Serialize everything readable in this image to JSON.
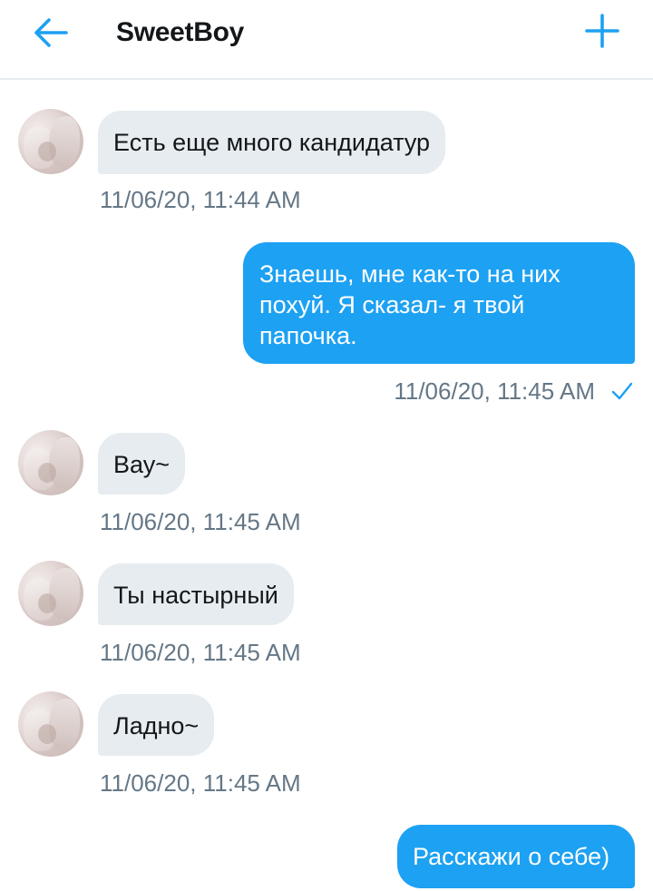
{
  "header": {
    "title": "SweetBoy",
    "back_icon": "arrow-left-icon",
    "add_icon": "plus-icon",
    "accent": "#1da1f2"
  },
  "messages": [
    {
      "direction": "in",
      "text": "Есть еще много кандидатур",
      "time": "11/06/20, 11:44 AM"
    },
    {
      "direction": "out",
      "text": "Знаешь, мне как-то на них похуй. Я сказал- я твой папочка.",
      "time": "11/06/20, 11:45 AM",
      "status_icon": "check-icon"
    },
    {
      "direction": "in",
      "text": "Вау~",
      "time": "11/06/20, 11:45 AM"
    },
    {
      "direction": "in",
      "text": "Ты настырный",
      "time": "11/06/20, 11:45 AM"
    },
    {
      "direction": "in",
      "text": "Ладно~",
      "time": "11/06/20, 11:45 AM"
    },
    {
      "direction": "out",
      "text": "Расскажи о себе)"
    }
  ],
  "colors": {
    "incoming_bubble": "#e6ecf0",
    "outgoing_bubble": "#1da1f2",
    "timestamp": "#657786",
    "text": "#14171a"
  }
}
